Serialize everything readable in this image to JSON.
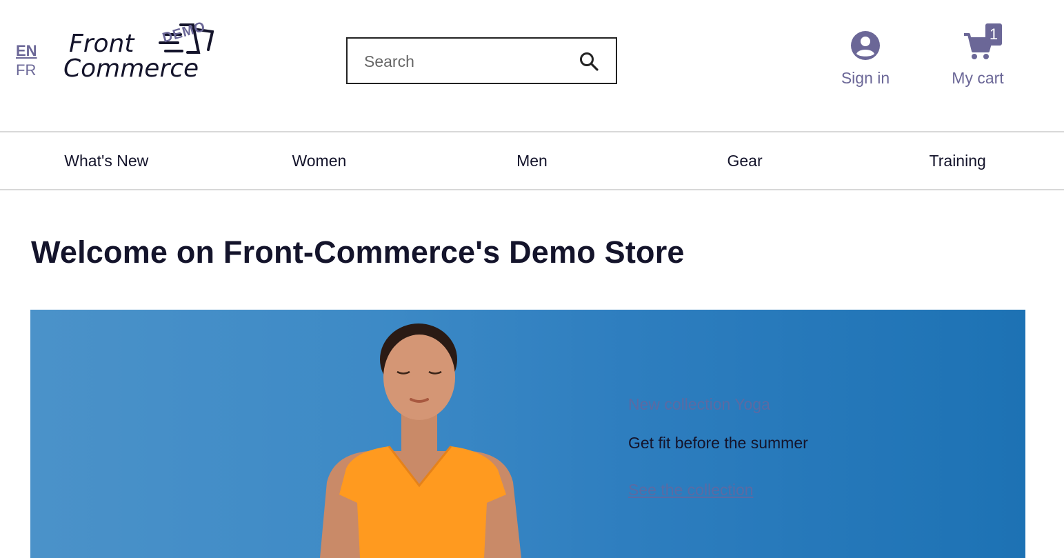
{
  "header": {
    "languages": {
      "active": "EN",
      "other": "FR"
    },
    "logo": {
      "line1": "Front",
      "line2": "Commerce",
      "badge": "DEMO"
    },
    "search": {
      "placeholder": "Search",
      "value": ""
    },
    "account": {
      "label": "Sign in",
      "icon": "user-circle-icon"
    },
    "cart": {
      "label": "My cart",
      "count": "1",
      "icon": "cart-icon"
    }
  },
  "nav": {
    "items": [
      {
        "label": "What's New"
      },
      {
        "label": "Women"
      },
      {
        "label": "Men"
      },
      {
        "label": "Gear"
      },
      {
        "label": "Training"
      }
    ]
  },
  "main": {
    "title": "Welcome on Front-Commerce's Demo Store",
    "hero": {
      "kicker": "New collection Yoga",
      "subtitle": "Get fit before the summer",
      "link": "See the collection"
    }
  },
  "colors": {
    "accent": "#6b6797",
    "text": "#14142b",
    "hero_sky": "#2e7ebf",
    "shirt": "#ff9a1f"
  }
}
